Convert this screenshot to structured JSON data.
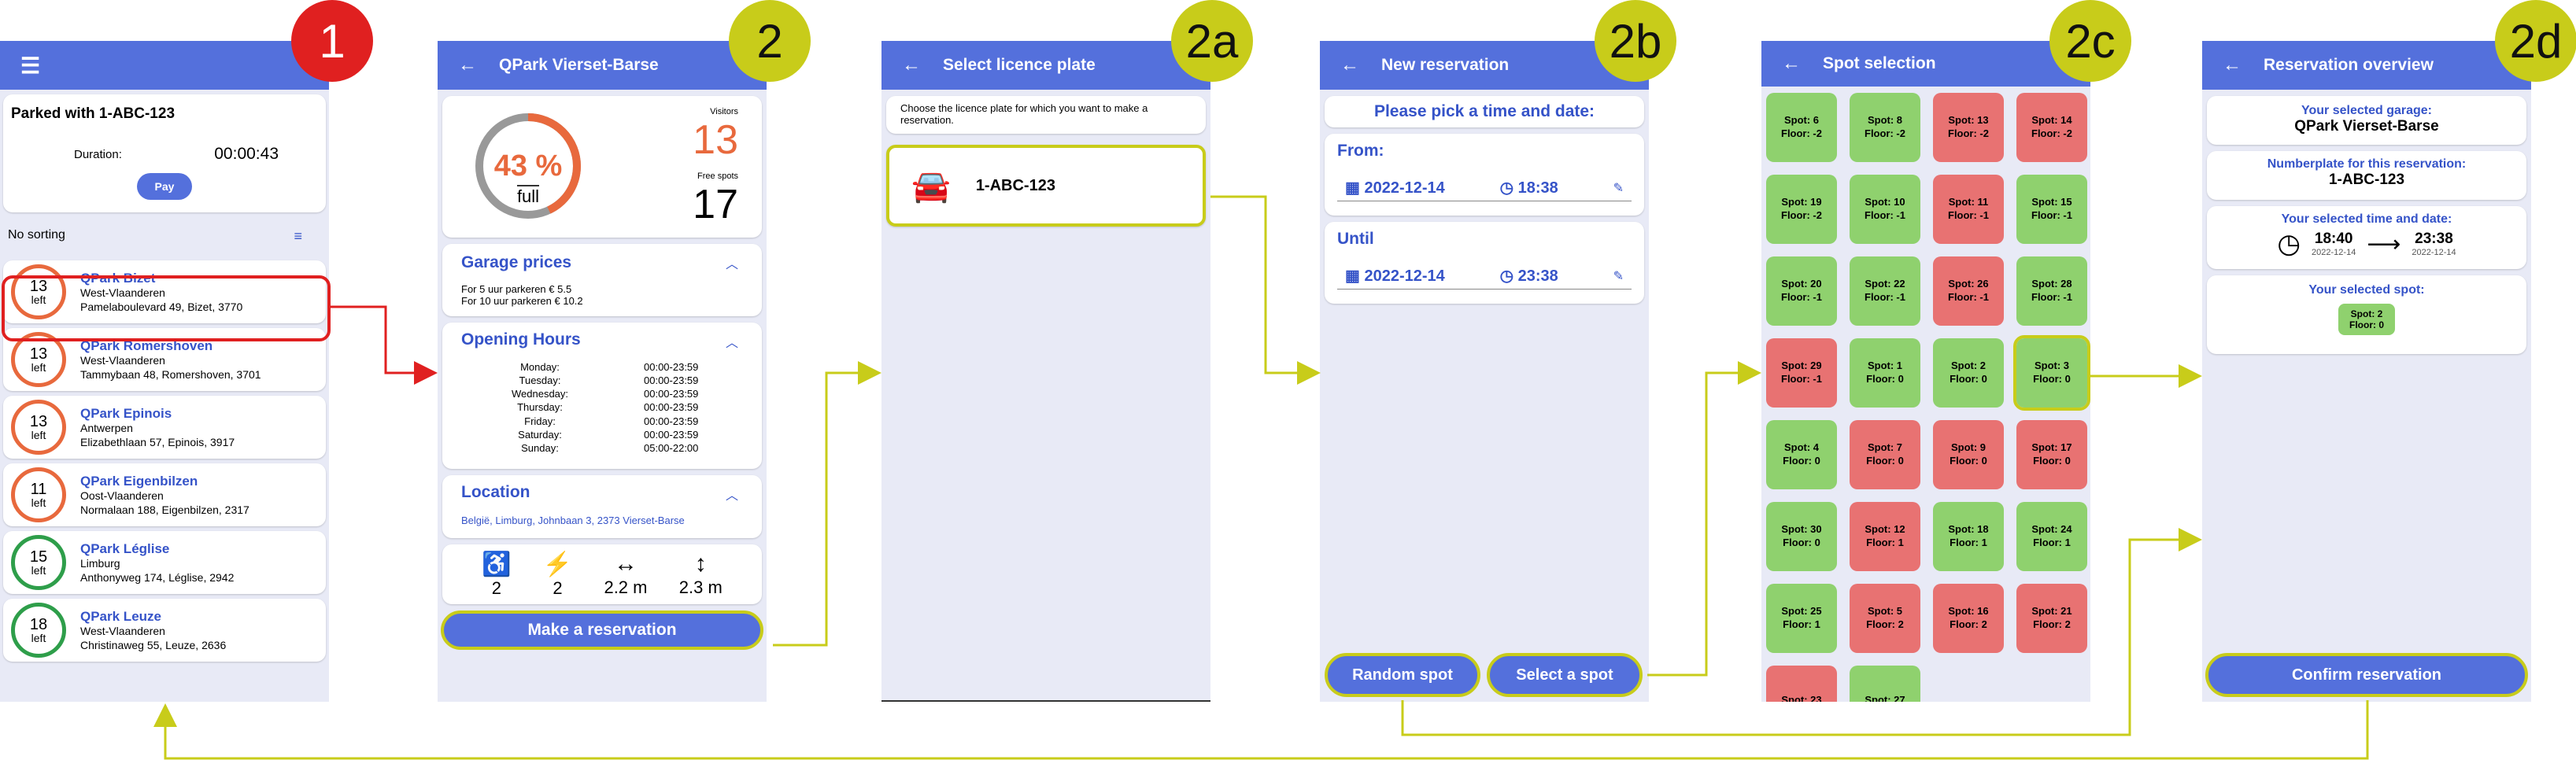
{
  "badges": [
    "1",
    "2",
    "2a",
    "2b",
    "2c",
    "2d"
  ],
  "screen1": {
    "menu_icon": "menu-icon",
    "parked_title": "Parked with 1-ABC-123",
    "duration_label": "Duration:",
    "duration_value": "00:00:43",
    "pay_label": "Pay",
    "sorting_label": "No sorting",
    "garages": [
      {
        "count": "13",
        "left": "left",
        "name": "QPark Bizet",
        "region": "West-Vlaanderen",
        "address": "Pamelaboulevard 49, Bizet, 3770"
      },
      {
        "count": "13",
        "left": "left",
        "name": "QPark Romershoven",
        "region": "West-Vlaanderen",
        "address": "Tammybaan 48, Romershoven, 3701"
      },
      {
        "count": "13",
        "left": "left",
        "name": "QPark Epinois",
        "region": "Antwerpen",
        "address": "Elizabethlaan 57, Epinois, 3917"
      },
      {
        "count": "11",
        "left": "left",
        "name": "QPark Eigenbilzen",
        "region": "Oost-Vlaanderen",
        "address": "Normalaan 188, Eigenbilzen, 2317"
      },
      {
        "count": "15",
        "left": "left",
        "name": "QPark Léglise",
        "region": "Limburg",
        "address": "Anthonyweg 174, Léglise, 2942"
      },
      {
        "count": "18",
        "left": "left",
        "name": "QPark Leuze",
        "region": "West-Vlaanderen",
        "address": "Christinaweg 55, Leuze, 2636"
      }
    ]
  },
  "screen2": {
    "title": "QPark Vierset-Barse",
    "percent": "43 %",
    "percent_value": 43,
    "full_label": "full",
    "visitors_label": "Visitors",
    "visitors": "13",
    "free_label": "Free spots",
    "free": "17",
    "prices_title": "Garage prices",
    "prices": [
      "For 5 uur parkeren € 5.5",
      "For 10 uur parkeren € 10.2"
    ],
    "hours_title": "Opening Hours",
    "hours": [
      {
        "day": "Monday:",
        "time": "00:00-23:59"
      },
      {
        "day": "Tuesday:",
        "time": "00:00-23:59"
      },
      {
        "day": "Wednesday:",
        "time": "00:00-23:59"
      },
      {
        "day": "Thursday:",
        "time": "00:00-23:59"
      },
      {
        "day": "Friday:",
        "time": "00:00-23:59"
      },
      {
        "day": "Saturday:",
        "time": "00:00-23:59"
      },
      {
        "day": "Sunday:",
        "time": "05:00-22:00"
      }
    ],
    "location_title": "Location",
    "location": "België, Limburg, Johnbaan 3, 2373 Vierset-Barse",
    "facilities": [
      {
        "icon": "wheelchair-icon",
        "value": "2"
      },
      {
        "icon": "ev-charger-icon",
        "value": "2"
      },
      {
        "icon": "width-arrows-icon",
        "value": "2.2 m"
      },
      {
        "icon": "height-arrows-icon",
        "value": "2.3 m"
      }
    ],
    "reserve_label": "Make a reservation"
  },
  "screen2a": {
    "title": "Select licence plate",
    "instruction": "Choose the licence plate for which you want to make a reservation.",
    "plate": "1-ABC-123"
  },
  "screen2b": {
    "title": "New reservation",
    "prompt": "Please pick a time and date:",
    "from_label": "From:",
    "from_date": "2022-12-14",
    "from_time": "18:38",
    "until_label": "Until",
    "until_date": "2022-12-14",
    "until_time": "23:38",
    "random_label": "Random spot",
    "select_label": "Select a spot"
  },
  "screen2c": {
    "title": "Spot selection",
    "spots": [
      {
        "spot": "Spot: 6",
        "floor": "Floor: -2",
        "s": "g"
      },
      {
        "spot": "Spot: 8",
        "floor": "Floor: -2",
        "s": "g"
      },
      {
        "spot": "Spot: 13",
        "floor": "Floor: -2",
        "s": "r"
      },
      {
        "spot": "Spot: 14",
        "floor": "Floor: -2",
        "s": "r"
      },
      {
        "spot": "Spot: 19",
        "floor": "Floor: -2",
        "s": "g"
      },
      {
        "spot": "Spot: 10",
        "floor": "Floor: -1",
        "s": "g"
      },
      {
        "spot": "Spot: 11",
        "floor": "Floor: -1",
        "s": "r"
      },
      {
        "spot": "Spot: 15",
        "floor": "Floor: -1",
        "s": "g"
      },
      {
        "spot": "Spot: 20",
        "floor": "Floor: -1",
        "s": "g"
      },
      {
        "spot": "Spot: 22",
        "floor": "Floor: -1",
        "s": "g"
      },
      {
        "spot": "Spot: 26",
        "floor": "Floor: -1",
        "s": "r"
      },
      {
        "spot": "Spot: 28",
        "floor": "Floor: -1",
        "s": "g"
      },
      {
        "spot": "Spot: 29",
        "floor": "Floor: -1",
        "s": "r"
      },
      {
        "spot": "Spot: 1",
        "floor": "Floor: 0",
        "s": "g"
      },
      {
        "spot": "Spot: 2",
        "floor": "Floor: 0",
        "s": "g"
      },
      {
        "spot": "Spot: 3",
        "floor": "Floor: 0",
        "s": "g",
        "sel": true
      },
      {
        "spot": "Spot: 4",
        "floor": "Floor: 0",
        "s": "g"
      },
      {
        "spot": "Spot: 7",
        "floor": "Floor: 0",
        "s": "r"
      },
      {
        "spot": "Spot: 9",
        "floor": "Floor: 0",
        "s": "r"
      },
      {
        "spot": "Spot: 17",
        "floor": "Floor: 0",
        "s": "r"
      },
      {
        "spot": "Spot: 30",
        "floor": "Floor: 0",
        "s": "g"
      },
      {
        "spot": "Spot: 12",
        "floor": "Floor: 1",
        "s": "r"
      },
      {
        "spot": "Spot: 18",
        "floor": "Floor: 1",
        "s": "g"
      },
      {
        "spot": "Spot: 24",
        "floor": "Floor: 1",
        "s": "g"
      },
      {
        "spot": "Spot: 25",
        "floor": "Floor: 1",
        "s": "g"
      },
      {
        "spot": "Spot: 5",
        "floor": "Floor: 2",
        "s": "r"
      },
      {
        "spot": "Spot: 16",
        "floor": "Floor: 2",
        "s": "r"
      },
      {
        "spot": "Spot: 21",
        "floor": "Floor: 2",
        "s": "r"
      },
      {
        "spot": "Spot: 23",
        "floor": "",
        "s": "r"
      },
      {
        "spot": "Spot: 27",
        "floor": "",
        "s": "g"
      }
    ]
  },
  "screen2d": {
    "title": "Reservation overview",
    "garage_label": "Your selected garage:",
    "garage": "QPark Vierset-Barse",
    "plate_label": "Numberplate for this reservation:",
    "plate": "1-ABC-123",
    "time_label": "Your selected time and date:",
    "from_time": "18:40",
    "from_date": "2022-12-14",
    "until_time": "23:38",
    "until_date": "2022-12-14",
    "spot_label": "Your selected spot:",
    "spot": "Spot: 2",
    "floor": "Floor: 0",
    "confirm_label": "Confirm reservation"
  },
  "colors": {
    "accent": "#5470dc",
    "flow": "#c8cc1a",
    "highlight_red": "#e02020",
    "free": "#8fd16e",
    "taken": "#e87272"
  }
}
